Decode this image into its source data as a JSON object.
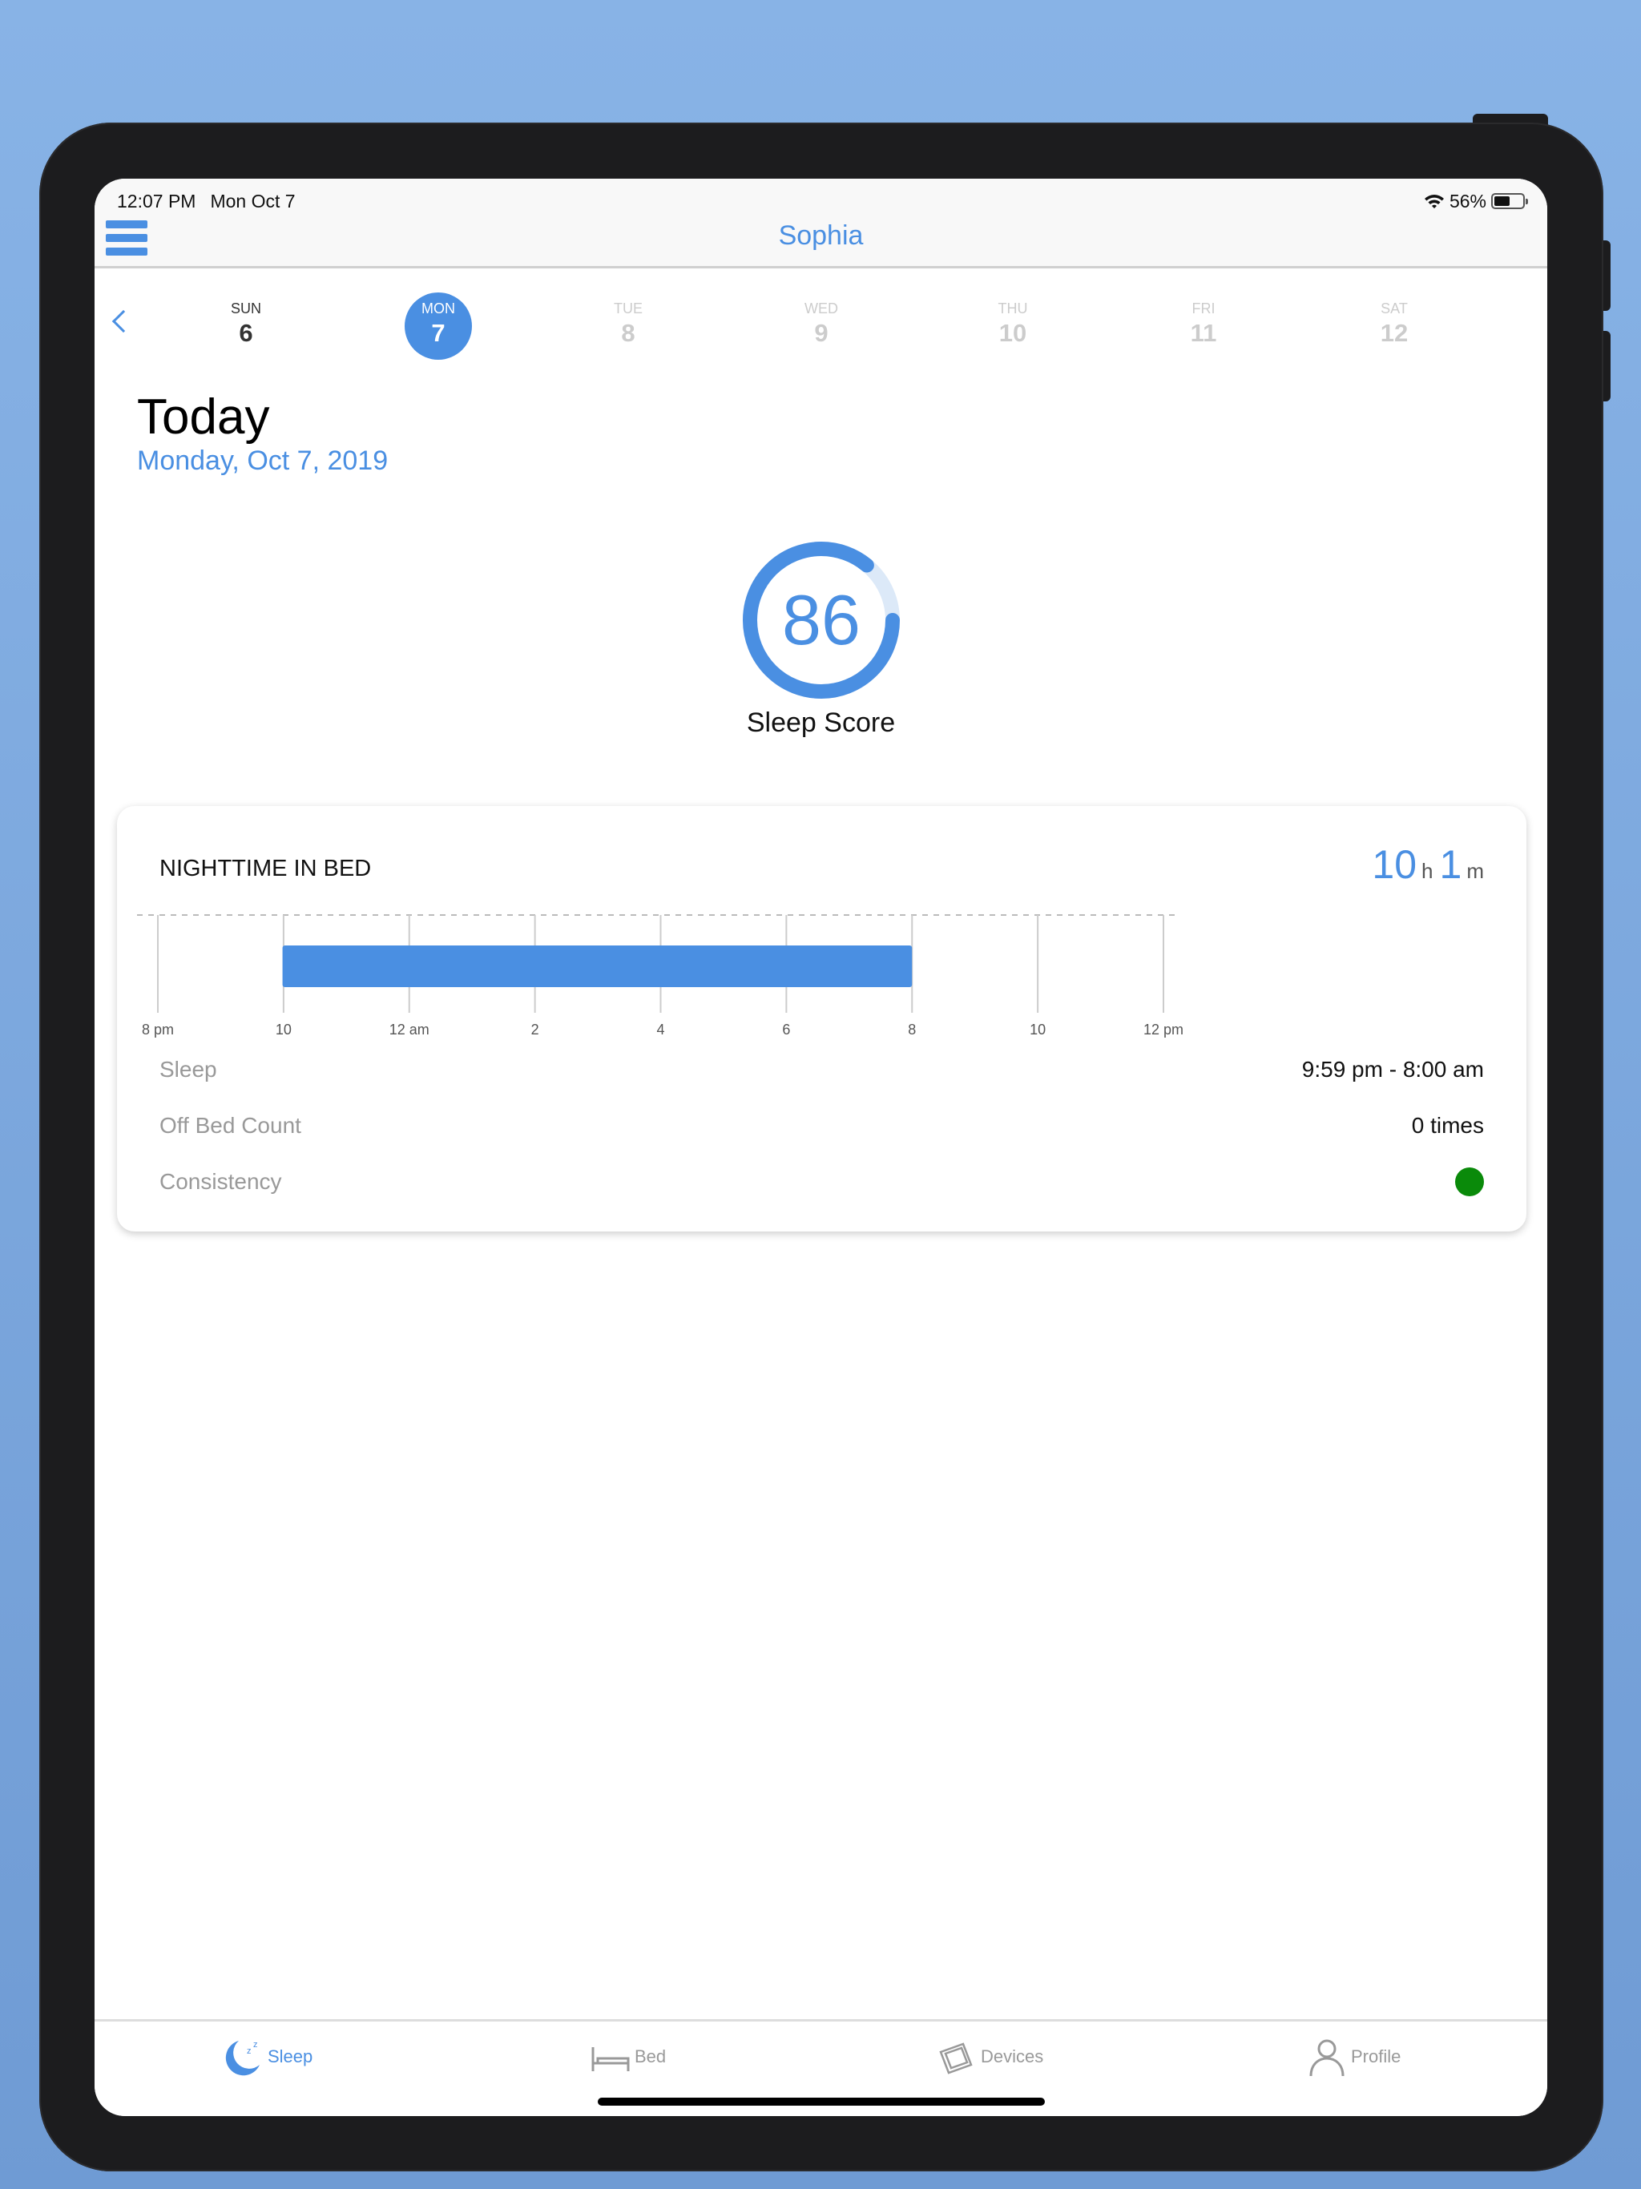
{
  "status_bar": {
    "time": "12:07 PM",
    "date": "Mon Oct 7",
    "battery": "56%",
    "battery_level": 0.56
  },
  "nav": {
    "title": "Sophia",
    "menu_icon": "hamburger-icon"
  },
  "week": [
    {
      "dn": "SUN",
      "dd": "6",
      "state": "past"
    },
    {
      "dn": "MON",
      "dd": "7",
      "state": "selected"
    },
    {
      "dn": "TUE",
      "dd": "8",
      "state": "future"
    },
    {
      "dn": "WED",
      "dd": "9",
      "state": "future"
    },
    {
      "dn": "THU",
      "dd": "10",
      "state": "future"
    },
    {
      "dn": "FRI",
      "dd": "11",
      "state": "future"
    },
    {
      "dn": "SAT",
      "dd": "12",
      "state": "future"
    }
  ],
  "header": {
    "title": "Today",
    "date": "Monday, Oct 7, 2019"
  },
  "score": {
    "value": "86",
    "label": "Sleep Score",
    "fraction": 0.86
  },
  "card": {
    "title": "NIGHTTIME IN BED",
    "duration": {
      "hours": "10",
      "h": "h",
      "minutes": "1",
      "m": "m"
    },
    "rows": [
      {
        "label": "Sleep",
        "value": "9:59 pm - 8:00 am"
      },
      {
        "label": "Off Bed Count",
        "value": "0 times"
      },
      {
        "label": "Consistency",
        "value": ""
      }
    ],
    "consistency_color": "#0a8a0a"
  },
  "chart_data": {
    "type": "bar",
    "orientation": "horizontal-timeline",
    "tick_labels": [
      "8 pm",
      "10",
      "12 am",
      "2",
      "4",
      "6",
      "8",
      "10",
      "12 pm"
    ],
    "xlim": [
      "8 pm",
      "12 pm"
    ],
    "bars": [
      {
        "start": "9:59 pm",
        "end": "8:00 am"
      }
    ],
    "bar_color": "#4a8fe2",
    "grid": true
  },
  "tabs": [
    {
      "label": "Sleep",
      "icon": "moon-icon",
      "active": true
    },
    {
      "label": "Bed",
      "icon": "bed-icon",
      "active": false
    },
    {
      "label": "Devices",
      "icon": "devices-icon",
      "active": false
    },
    {
      "label": "Profile",
      "icon": "profile-icon",
      "active": false
    }
  ],
  "colors": {
    "accent": "#4a8fe2",
    "background": "#86b0e4"
  }
}
